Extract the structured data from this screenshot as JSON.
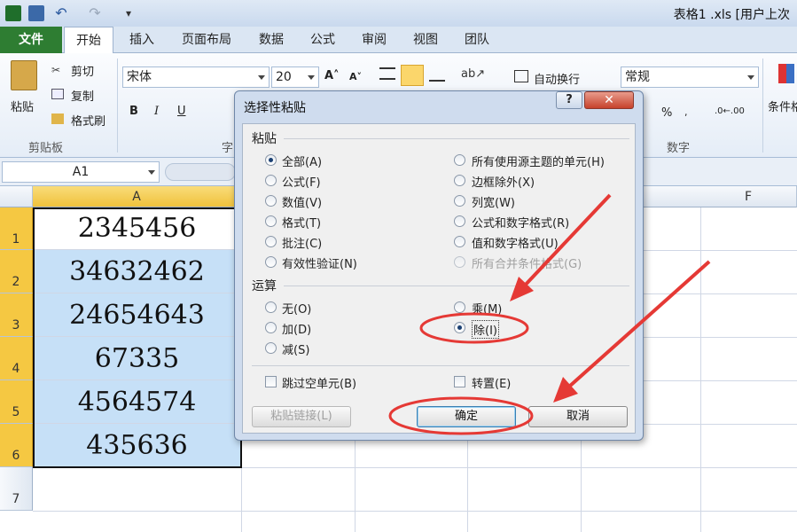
{
  "window": {
    "title": "表格1 .xls [用户上次"
  },
  "tabs": [
    "文件",
    "开始",
    "插入",
    "页面布局",
    "数据",
    "公式",
    "审阅",
    "视图",
    "团队"
  ],
  "ribbon": {
    "clipboard": {
      "paste": "粘贴",
      "cut": "剪切",
      "copy": "复制",
      "format_painter": "格式刷",
      "group": "剪贴板"
    },
    "font": {
      "name": "宋体",
      "size": "20",
      "bold": "B",
      "italic": "I",
      "underline": "U",
      "group": "字"
    },
    "alignment": {
      "wrap": "自动换行"
    },
    "number": {
      "format": "常规",
      "percent": "%",
      "group": "数字"
    },
    "styles": {
      "cond": "条件格"
    }
  },
  "formula_bar": {
    "name_box": "A1"
  },
  "sheet": {
    "columns": [
      "A",
      "F"
    ],
    "rows": [
      {
        "num": "1",
        "value": "2345456"
      },
      {
        "num": "2",
        "value": "34632462"
      },
      {
        "num": "3",
        "value": "24654643"
      },
      {
        "num": "4",
        "value": "67335"
      },
      {
        "num": "5",
        "value": "4564574"
      },
      {
        "num": "6",
        "value": "435636"
      },
      {
        "num": "7",
        "value": ""
      }
    ]
  },
  "dialog": {
    "title": "选择性粘贴",
    "help": "?",
    "close": "✕",
    "paste_section": "粘贴",
    "paste_left": [
      "全部(A)",
      "公式(F)",
      "数值(V)",
      "格式(T)",
      "批注(C)",
      "有效性验证(N)"
    ],
    "paste_right": [
      "所有使用源主题的单元(H)",
      "边框除外(X)",
      "列宽(W)",
      "公式和数字格式(R)",
      "值和数字格式(U)",
      "所有合并条件格式(G)"
    ],
    "op_section": "运算",
    "op_left": [
      "无(O)",
      "加(D)",
      "减(S)"
    ],
    "op_right": [
      "乘(M)",
      "除(I)"
    ],
    "skip_blanks": "跳过空单元(B)",
    "transpose": "转置(E)",
    "paste_link": "粘贴链接(L)",
    "ok": "确定",
    "cancel": "取消"
  },
  "colors": {
    "accent_red": "#e53935",
    "selection": "#c6e0f7",
    "file_tab": "#2e7d32"
  }
}
